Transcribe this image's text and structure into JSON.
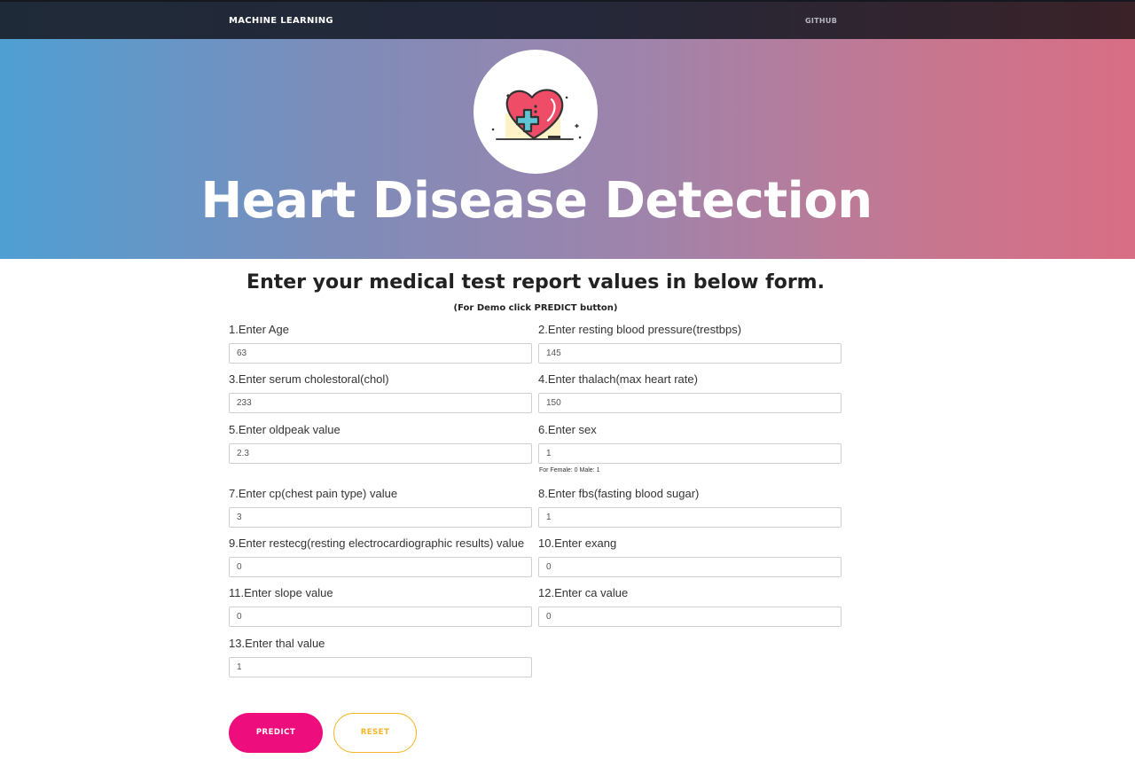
{
  "navbar": {
    "brand": "MACHINE LEARNING",
    "link": "GITHUB"
  },
  "hero": {
    "title": "Heart Disease Detection",
    "logo_icon": "heart-plus-icon"
  },
  "form": {
    "heading": "Enter your medical test report values in below form.",
    "subheading": "(For Demo click PREDICT button)",
    "fields": [
      {
        "label": "1.Enter Age",
        "value": "63"
      },
      {
        "label": "2.Enter resting blood pressure(trestbps)",
        "value": "145"
      },
      {
        "label": "3.Enter serum cholestoral(chol)",
        "value": "233"
      },
      {
        "label": "4.Enter thalach(max heart rate)",
        "value": "150"
      },
      {
        "label": "5.Enter oldpeak value",
        "value": "2.3"
      },
      {
        "label": "6.Enter sex",
        "value": "1",
        "help": "For Female: 0 Male: 1"
      },
      {
        "label": "7.Enter cp(chest pain type) value",
        "value": "3"
      },
      {
        "label": "8.Enter fbs(fasting blood sugar)",
        "value": "1"
      },
      {
        "label": "9.Enter restecg(resting electrocardiographic results) value",
        "value": "0"
      },
      {
        "label": "10.Enter exang",
        "value": "0"
      },
      {
        "label": "11.Enter slope value",
        "value": "0"
      },
      {
        "label": "12.Enter ca value",
        "value": "0"
      },
      {
        "label": "13.Enter thal value",
        "value": "1"
      }
    ],
    "predict_label": "PREDICT",
    "reset_label": "RESET"
  },
  "colors": {
    "predict_button": "#ee0d7c",
    "reset_button": "#f5b525",
    "hero_gradient_start": "#4f9fd3",
    "hero_gradient_end": "#d86e85"
  }
}
